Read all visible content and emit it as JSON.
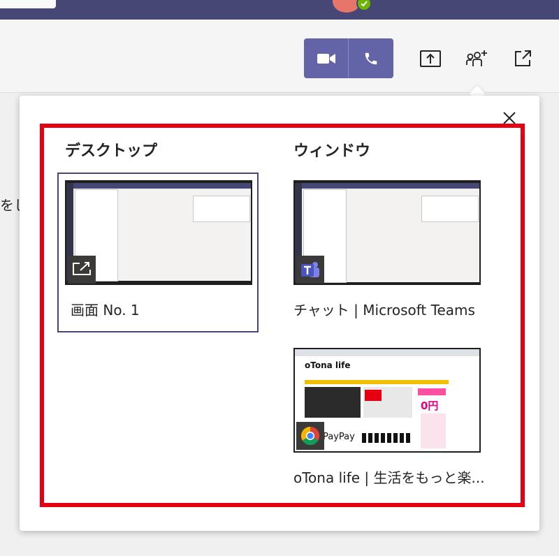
{
  "header": {
    "video_call_icon": "video-camera-icon",
    "audio_call_icon": "phone-icon",
    "share_icon": "share-screen-icon",
    "add_people_icon": "add-people-icon",
    "popout_icon": "pop-out-icon",
    "accent_color": "#6264a7",
    "titlebar_color": "#464775"
  },
  "background": {
    "partial_text": "をし"
  },
  "share_panel": {
    "close_icon": "close-icon",
    "highlight_color": "#e60012",
    "desktop": {
      "title": "デスクトップ",
      "items": [
        {
          "label": "画面 No. 1",
          "badge_icon": "screen-share-icon"
        }
      ]
    },
    "window": {
      "title": "ウィンドウ",
      "items": [
        {
          "label": "チャット | Microsoft Teams",
          "badge_icon": "teams-icon"
        },
        {
          "label": "oTona life | 生活をもっと楽...",
          "badge_icon": "chrome-icon",
          "preview_text": [
            "oTona life",
            "PayPay",
            "0円"
          ]
        }
      ]
    }
  }
}
